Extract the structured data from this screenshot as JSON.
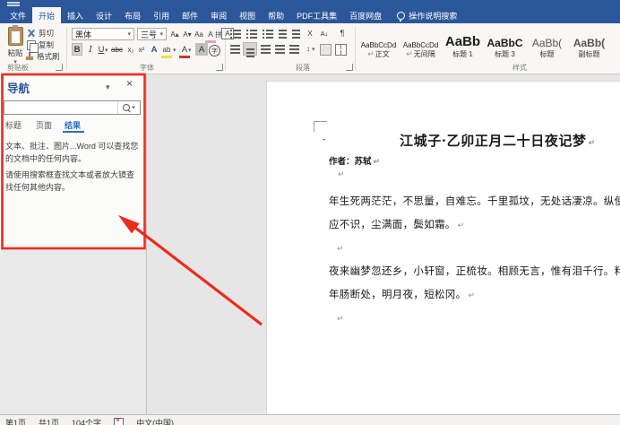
{
  "app": {
    "accent_color": "#2b579a",
    "annotation_color": "#ee2a1c"
  },
  "titlebar": {
    "tabs": [
      {
        "label": "文件"
      },
      {
        "label": "开始",
        "active": true
      },
      {
        "label": "插入"
      },
      {
        "label": "设计"
      },
      {
        "label": "布局"
      },
      {
        "label": "引用"
      },
      {
        "label": "邮件"
      },
      {
        "label": "审阅"
      },
      {
        "label": "视图"
      },
      {
        "label": "帮助"
      },
      {
        "label": "PDF工具集"
      },
      {
        "label": "百度网盘"
      }
    ],
    "tell_me": "操作说明搜索"
  },
  "ribbon": {
    "clipboard": {
      "label": "剪贴板",
      "paste": "粘贴",
      "cut": "剪切",
      "copy": "复制",
      "format_painter": "格式刷"
    },
    "font": {
      "label": "字体",
      "name": "黑体",
      "size": "三号"
    },
    "paragraph": {
      "label": "段落"
    },
    "styles": {
      "label": "样式",
      "items": [
        {
          "prefix": "↵",
          "preview": "AaBbCcDd",
          "name": "正文"
        },
        {
          "prefix": "↵",
          "preview": "AaBbCcDd",
          "name": "无间隔"
        },
        {
          "prefix": "",
          "preview": "AaBb",
          "name": "标题 1"
        },
        {
          "prefix": "",
          "preview": "AaBbC",
          "name": "标题 3"
        },
        {
          "prefix": "",
          "preview": "AaBb(",
          "name": "标题"
        },
        {
          "prefix": "",
          "preview": "AaBb(",
          "name": "副标题"
        }
      ]
    }
  },
  "icons": {
    "dropdown": "▾",
    "close": "×",
    "pilcrow": "↵",
    "bold": "B",
    "italic": "I",
    "underline": "U",
    "strikethrough": "abc",
    "subscript": "x₂",
    "superscript": "x²",
    "grow_font": "A▴",
    "shrink_font": "A▾",
    "change_case": "Aa",
    "clear_formatting": "A",
    "phonetic_guide": "拼",
    "character_border": "A",
    "text_effects": "A",
    "text_highlight": "ab",
    "font_color": "A",
    "character_shading": "A",
    "enclose_character": "字",
    "asian_layout": "X",
    "sort": "A↓",
    "paragraph_mark": "¶",
    "line_spacing": "↕"
  },
  "nav_pane": {
    "title": "导航",
    "search_placeholder": "",
    "tabs": [
      {
        "label": "标题"
      },
      {
        "label": "页面"
      },
      {
        "label": "结果",
        "active": true
      }
    ],
    "description_1": "文本、批注、图片...Word 可以查找您的文档中的任何内容。",
    "description_2": "请使用搜索框查找文本或者放大镜查找任何其他内容。"
  },
  "document": {
    "bullet": "·",
    "title": "江城子·乙卯正月二十日夜记梦",
    "author": "作者：苏轼",
    "lines": [
      {
        "text": "年生死两茫茫，不思量，自难忘。千里孤坟，无处话凄凉。纵使相逢",
        "pilcrow": ""
      },
      {
        "text": "应不识，尘满面，鬓如霜。",
        "pilcrow": "↵"
      },
      {
        "text": "",
        "pilcrow": "↵"
      },
      {
        "text": "夜来幽梦忽还乡，小轩窗，正梳妆。相顾无言，惟有泪千行。料得年",
        "pilcrow": ""
      },
      {
        "text": "年肠断处，明月夜，短松冈。",
        "pilcrow": "↵"
      },
      {
        "text": "",
        "pilcrow": "↵"
      }
    ]
  },
  "status_bar": {
    "page": "第1页",
    "total_pages": "共1页",
    "word_count": "104个字",
    "language": "中文(中国)"
  }
}
